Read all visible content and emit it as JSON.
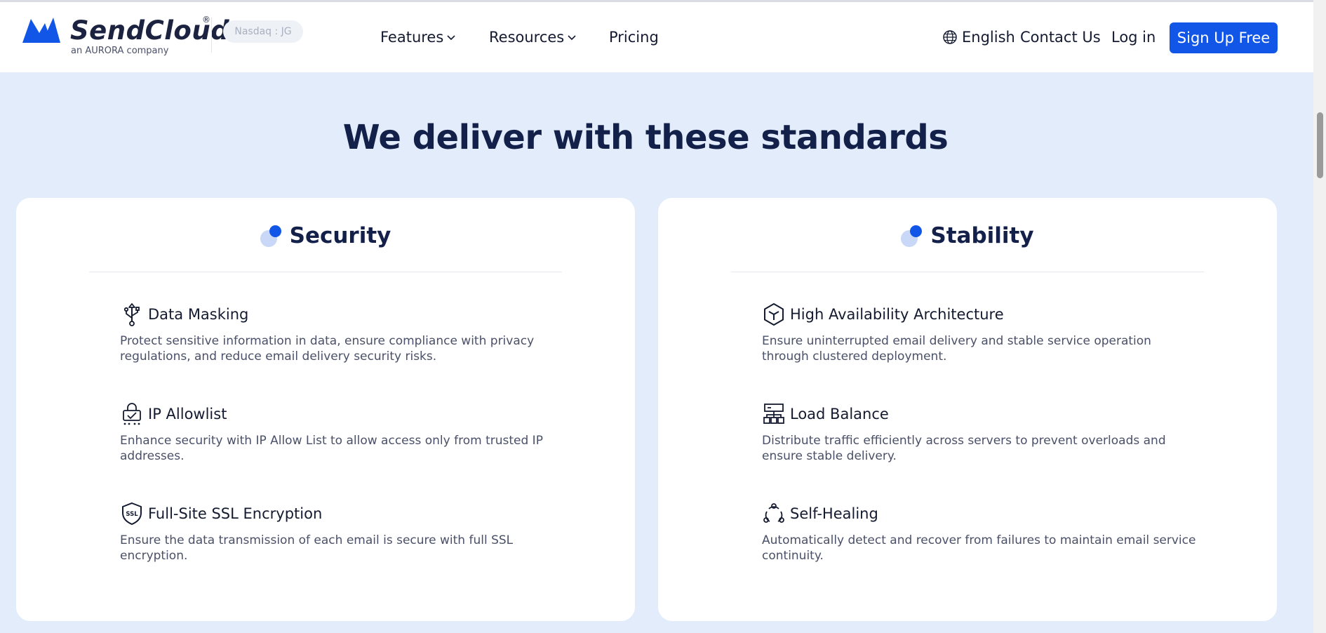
{
  "brand": {
    "name": "SendCloud",
    "registered_mark": "®",
    "tagline": "an AURORA company",
    "ticker": "Nasdaq : JG",
    "accent_color": "#1256e8"
  },
  "nav": {
    "features_label": "Features",
    "resources_label": "Resources",
    "pricing_label": "Pricing",
    "language_label": "English",
    "contact_label": "Contact Us",
    "login_label": "Log in",
    "signup_label": "Sign Up Free"
  },
  "section": {
    "title": "We deliver with these standards"
  },
  "cards": [
    {
      "title": "Security",
      "features": [
        {
          "icon": "usb-icon",
          "title": "Data Masking",
          "description": "Protect sensitive information in data, ensure compliance with privacy regulations, and reduce email delivery security risks."
        },
        {
          "icon": "lock-network-icon",
          "title": "IP Allowlist",
          "description": "Enhance security with IP Allow List to allow access only from trusted IP addresses."
        },
        {
          "icon": "ssl-shield-icon",
          "title": "Full-Site SSL Encryption",
          "description": "Ensure the data transmission of each email is secure with full SSL encryption."
        }
      ]
    },
    {
      "title": "Stability",
      "features": [
        {
          "icon": "cube-icon",
          "title": "High Availability Architecture",
          "description": "Ensure uninterrupted email delivery and stable service operation through clustered deployment."
        },
        {
          "icon": "server-hierarchy-icon",
          "title": "Load Balance",
          "description": "Distribute traffic efficiently across servers to prevent overloads and ensure stable delivery."
        },
        {
          "icon": "self-healing-icon",
          "title": "Self-Healing",
          "description": "Automatically detect and recover from failures to maintain email service continuity."
        }
      ]
    }
  ]
}
